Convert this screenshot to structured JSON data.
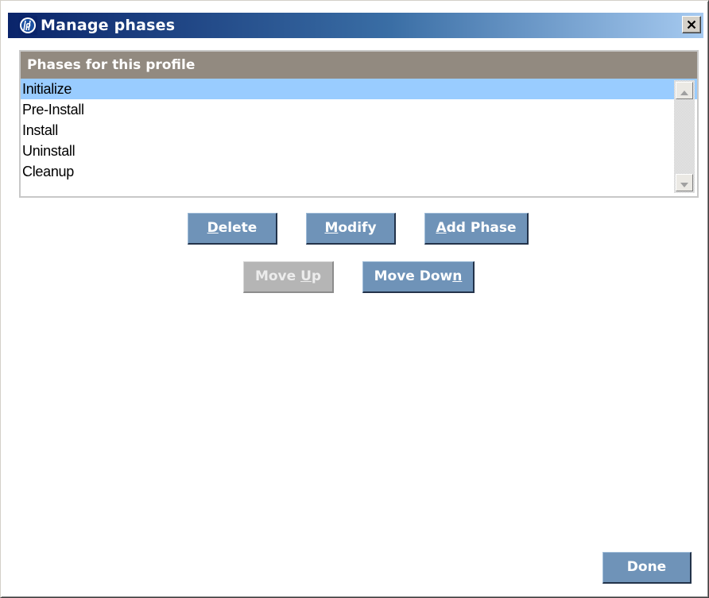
{
  "window": {
    "title": "Manage phases",
    "close_symbol": "×"
  },
  "icons": {
    "app": "hp-logo-icon",
    "close": "close-icon",
    "scroll_up": "triangle-up-icon",
    "scroll_down": "triangle-down-icon"
  },
  "colors": {
    "title_gradient_start": "#0a246a",
    "title_gradient_end": "#a6caf0",
    "list_header_bg": "#928a80",
    "selection_bg": "#99ccff",
    "button_bg": "#6f93b8",
    "button_disabled_bg": "#b5b5b5"
  },
  "phases_list": {
    "header": "Phases for this profile",
    "items": [
      "Initialize",
      "Pre-Install",
      "Install",
      "Uninstall",
      "Cleanup"
    ],
    "selected": "Initialize"
  },
  "buttons": {
    "delete": {
      "before": "",
      "mnemonic": "D",
      "after": "elete",
      "enabled": true
    },
    "modify": {
      "before": "",
      "mnemonic": "M",
      "after": "odify",
      "enabled": true
    },
    "add_phase": {
      "before": "",
      "mnemonic": "A",
      "after": "dd Phase",
      "enabled": true
    },
    "move_up": {
      "before": "Move ",
      "mnemonic": "U",
      "after": "p",
      "enabled": false
    },
    "move_down": {
      "before": "Move Dow",
      "mnemonic": "n",
      "after": "",
      "enabled": true
    },
    "done": {
      "label": "Done",
      "enabled": true
    }
  }
}
